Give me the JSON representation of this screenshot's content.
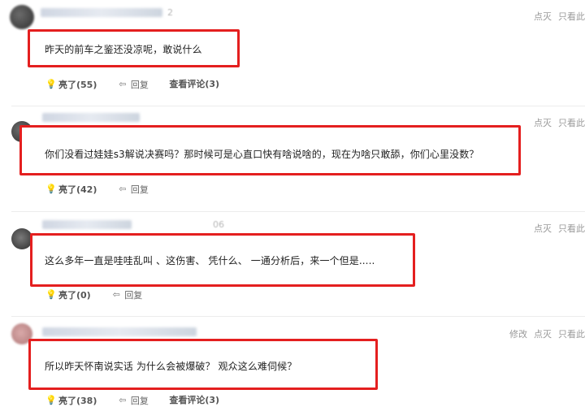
{
  "comments": [
    {
      "meta_suffix": "2",
      "actions": [
        "点灭",
        "只看此"
      ],
      "text": "昨天的前车之鉴还没凉呢，敢说什么",
      "like": "亮了(55)",
      "reply": "回复",
      "view": "查看评论(3)"
    },
    {
      "meta_suffix": "",
      "actions": [
        "点灭",
        "只看此"
      ],
      "text": "你们没看过娃娃s3解说决赛吗？那时候可是心直口快有啥说啥的，现在为啥只敢舔，你们心里没数？",
      "like": "亮了(42)",
      "reply": "回复",
      "view": ""
    },
    {
      "meta_suffix": "06",
      "actions": [
        "点灭",
        "只看此"
      ],
      "text": "这么多年一直是哇哇乱叫 、这伤害、 凭什么、 一通分析后，来一个但是.....",
      "like": "亮了(0)",
      "reply": "回复",
      "view": ""
    },
    {
      "meta_suffix": "",
      "actions": [
        "修改",
        "点灭",
        "只看此"
      ],
      "text": "所以昨天怀南说实话  为什么会被爆破？  观众这么难伺候？",
      "like": "亮了(38)",
      "reply": "回复",
      "view": "查看评论(3)"
    }
  ],
  "icons": {
    "like": "lightbulb-icon",
    "reply": "reply-arrow-icon"
  },
  "colors": {
    "highlight_border": "#e41f1f",
    "action_text": "#999999",
    "separator": "#ececec"
  }
}
